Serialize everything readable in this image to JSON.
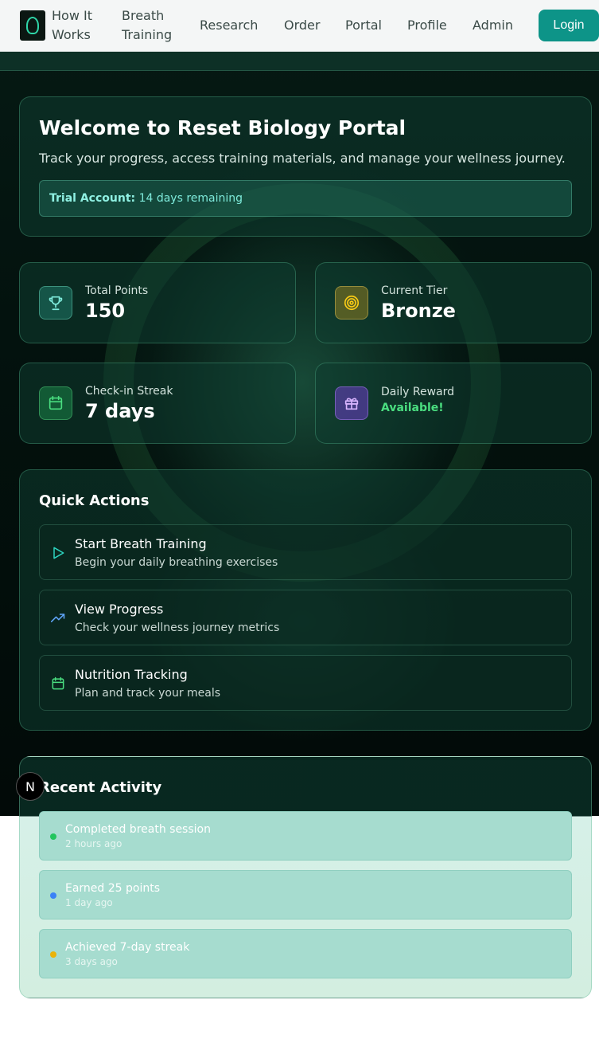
{
  "nav": {
    "links": [
      "How It Works",
      "Breath Training",
      "Research",
      "Order",
      "Portal",
      "Profile",
      "Admin"
    ],
    "how_line1": "How It",
    "how_line2": "Works",
    "breath_line1": "Breath",
    "breath_line2": "Training",
    "research": "Research",
    "order": "Order",
    "portal": "Portal",
    "profile": "Profile",
    "admin": "Admin",
    "login": "Login"
  },
  "welcome": {
    "title": "Welcome to Reset Biology Portal",
    "subtitle": "Track your progress, access training materials, and manage your wellness journey.",
    "trial_label": "Trial Account:",
    "trial_text": "14 days remaining"
  },
  "stats": {
    "points_label": "Total Points",
    "points_value": "150",
    "tier_label": "Current Tier",
    "tier_value": "Bronze",
    "streak_label": "Check-in Streak",
    "streak_value": "7 days",
    "reward_label": "Daily Reward",
    "reward_value": "Available!"
  },
  "quick_actions": {
    "title": "Quick Actions",
    "items": [
      {
        "title": "Start Breath Training",
        "desc": "Begin your daily breathing exercises",
        "icon": "play-icon"
      },
      {
        "title": "View Progress",
        "desc": "Check your wellness journey metrics",
        "icon": "trending-up-icon"
      },
      {
        "title": "Nutrition Tracking",
        "desc": "Plan and track your meals",
        "icon": "calendar-icon"
      }
    ]
  },
  "recent": {
    "title": "Recent Activity",
    "items": [
      {
        "title": "Completed breath session",
        "time": "2 hours ago",
        "color": "#22c55e"
      },
      {
        "title": "Earned 25 points",
        "time": "1 day ago",
        "color": "#3b82f6"
      },
      {
        "title": "Achieved 7-day streak",
        "time": "3 days ago",
        "color": "#eab308"
      }
    ]
  },
  "badge": "N",
  "colors": {
    "accent": "#0d9488",
    "reward_green": "#4ade80"
  }
}
